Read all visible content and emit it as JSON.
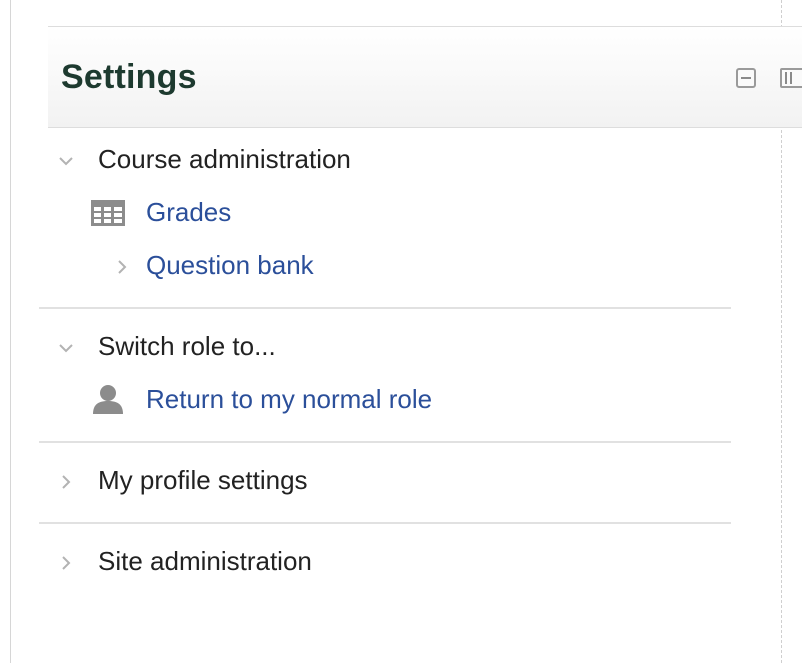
{
  "block": {
    "title": "Settings",
    "collapse_icon": "collapse-icon",
    "dock_icon": "dock-icon"
  },
  "tree": {
    "course_admin": {
      "label": "Course administration",
      "state": "expanded",
      "children": {
        "grades": {
          "label": "Grades",
          "icon": "grades-table-icon"
        },
        "question_bank": {
          "label": "Question bank",
          "state": "collapsed"
        }
      }
    },
    "switch_role": {
      "label": "Switch role to...",
      "state": "expanded",
      "children": {
        "return_role": {
          "label": "Return to my normal role",
          "icon": "user-icon"
        }
      }
    },
    "profile_settings": {
      "label": "My profile settings",
      "state": "collapsed"
    },
    "site_admin": {
      "label": "Site administration",
      "state": "collapsed"
    }
  },
  "colors": {
    "title": "#1d3a2f",
    "link": "#2b4f9a",
    "text": "#222222",
    "separator": "#e1e1e1"
  }
}
